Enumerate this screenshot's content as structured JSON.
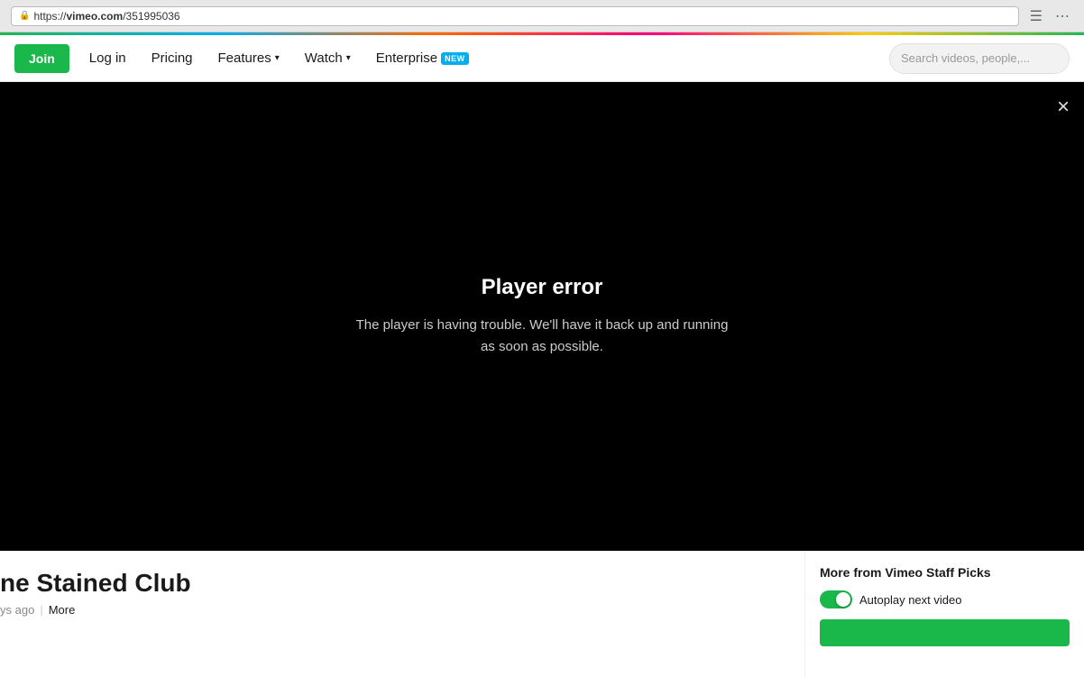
{
  "browser": {
    "url_prefix": "https://",
    "url_domain": "vimeo.com",
    "url_path": "/351995036",
    "lock_icon": "🔒"
  },
  "navbar": {
    "join_label": "Join",
    "login_label": "Log in",
    "pricing_label": "Pricing",
    "features_label": "Features",
    "watch_label": "Watch",
    "enterprise_label": "Enterprise",
    "enterprise_badge": "NEW",
    "search_placeholder": "Search videos, people,..."
  },
  "player": {
    "error_title": "Player error",
    "error_message": "The player is having trouble. We'll have it back up and running as soon as possible.",
    "close_label": "×"
  },
  "video": {
    "title": "ne Stained Club",
    "time_ago": "ys ago",
    "more_label": "More"
  },
  "sidebar": {
    "title": "More from Vimeo Staff Picks",
    "autoplay_label": "Autoplay next video"
  }
}
